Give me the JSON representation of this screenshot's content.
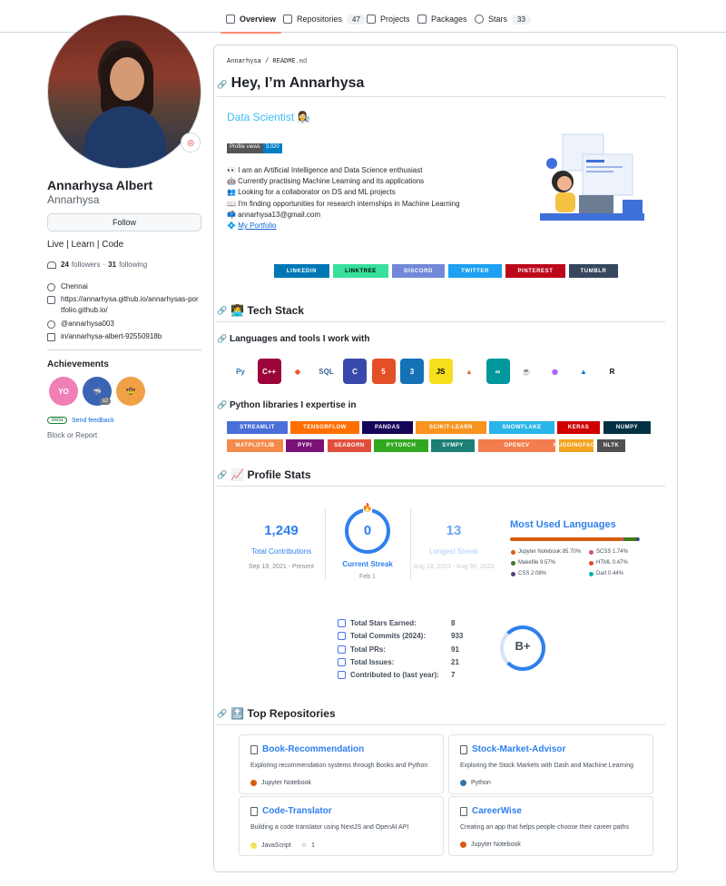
{
  "nav": {
    "tabs": [
      {
        "label": "Overview",
        "icon": "book-icon"
      },
      {
        "label": "Repositories",
        "icon": "repo-icon",
        "count": "47"
      },
      {
        "label": "Projects",
        "icon": "table-icon"
      },
      {
        "label": "Packages",
        "icon": "package-icon"
      },
      {
        "label": "Stars",
        "icon": "star-icon",
        "count": "33"
      }
    ]
  },
  "profile": {
    "full_name": "Annarhysa Albert",
    "login": "Annarhysa",
    "follow_label": "Follow",
    "bio": "Live | Learn | Code",
    "followers_count": "24",
    "followers_label": "followers",
    "dot": "·",
    "following_count": "31",
    "following_label": "following",
    "location": "Chennai",
    "website": "https://annarhysa.github.io/annarhysas-portfolio.github.io/",
    "twitter": "@annarhysa003",
    "linkedin": "in/annarhysa-albert-92550918b",
    "achievements_title": "Achievements",
    "achievements": [
      {
        "name": "YOLO",
        "color": "#ef7fb5"
      },
      {
        "name": "Pull Shark",
        "color": "#3c64b5",
        "multiplier": "x2"
      },
      {
        "name": "Quickdraw",
        "color": "#f0a045"
      }
    ],
    "beta_label": "Beta",
    "feedback_label": "Send feedback",
    "block_label": "Block or Report"
  },
  "readme": {
    "breadcrumb_user": "Annarhysa",
    "breadcrumb_sep": "/",
    "breadcrumb_file": "README",
    "breadcrumb_ext": ".md",
    "title": "Hey, I’m Annarhysa",
    "typing_text": "Data Scientist 👩‍🔬",
    "views_label": "Profile views",
    "views_count": "3,020",
    "about": [
      "👀 I am an Artificial Intelligence and Data Science enthusiast",
      "🤖 Currently practising Machine Learning and its applications",
      "👥 Looking for a collaborator on DS and ML projects",
      "📖 I'm finding opportunities for research internships in Machine Learning",
      "📫 annarhysa13@gmail.com",
      "💠"
    ],
    "portfolio_link": "My Portfolio",
    "socials": [
      {
        "label": "LINKEDIN",
        "color": "#0077b5"
      },
      {
        "label": "LINKTREE",
        "color": "#39e09b",
        "text_color": "#000000"
      },
      {
        "label": "DISCORD",
        "color": "#7289da"
      },
      {
        "label": "TWITTER",
        "color": "#1da1f2"
      },
      {
        "label": "PINTEREST",
        "color": "#bd081c"
      },
      {
        "label": "TUMBLR",
        "color": "#36465d"
      }
    ],
    "tech_stack_heading": "👩‍💻 Tech Stack",
    "languages_heading": "Languages and tools I work with",
    "tools": [
      {
        "name": "python-icon",
        "glyph": "Py",
        "bg": "#ffffff",
        "fg": "#3776ab"
      },
      {
        "name": "cplusplus-icon",
        "glyph": "C++",
        "bg": "#9c033a",
        "fg": "#ffffff"
      },
      {
        "name": "git-icon",
        "glyph": "◆",
        "bg": "#ffffff",
        "fg": "#f05032"
      },
      {
        "name": "sql-icon",
        "glyph": "SQL",
        "bg": "#ffffff",
        "fg": "#336791"
      },
      {
        "name": "c-icon",
        "glyph": "C",
        "bg": "#3949ab",
        "fg": "#ffffff"
      },
      {
        "name": "html5-icon",
        "glyph": "5",
        "bg": "#e34f26",
        "fg": "#ffffff"
      },
      {
        "name": "css3-icon",
        "glyph": "3",
        "bg": "#1572b6",
        "fg": "#ffffff"
      },
      {
        "name": "javascript-icon",
        "glyph": "JS",
        "bg": "#f7df1e",
        "fg": "#000000"
      },
      {
        "name": "matlab-icon",
        "glyph": "▲",
        "bg": "#ffffff",
        "fg": "#e16737"
      },
      {
        "name": "arduino-icon",
        "glyph": "∞",
        "bg": "#00979d",
        "fg": "#ffffff"
      },
      {
        "name": "java-icon",
        "glyph": "☕",
        "bg": "#ffffff",
        "fg": "#e76f00"
      },
      {
        "name": "figma-icon",
        "glyph": "◉",
        "bg": "#ffffff",
        "fg": "#a259ff"
      },
      {
        "name": "azure-icon",
        "glyph": "▲",
        "bg": "#ffffff",
        "fg": "#0078d4"
      },
      {
        "name": "rust-icon",
        "glyph": "R",
        "bg": "#ffffff",
        "fg": "#000000"
      }
    ],
    "libraries_heading": "Python libraries I expertise in",
    "libraries": [
      {
        "label": "STREAMLIT",
        "color": "#4a6fd8"
      },
      {
        "label": "TENSORFLOW",
        "color": "#ff6f00"
      },
      {
        "label": "PANDAS",
        "color": "#150458"
      },
      {
        "label": "SCIKIT-LEARN",
        "color": "#f7931e"
      },
      {
        "label": "SNOWFLAKE",
        "color": "#29b5e8"
      },
      {
        "label": "KERAS",
        "color": "#d00000"
      },
      {
        "label": "NUMPY",
        "color": "#013243"
      },
      {
        "label": "MATPLOTLIB",
        "color": "#f58a4b"
      },
      {
        "label": "PYPI",
        "color": "#7b1278"
      },
      {
        "label": "SEABORN",
        "color": "#e04f3c"
      },
      {
        "label": "PYTORCH",
        "color": "#31a81f"
      },
      {
        "label": "SYMPY",
        "color": "#1b7f75"
      },
      {
        "label": "OPENCV",
        "color": "#f47d4d"
      },
      {
        "label": "HUGGINGFACE",
        "color": "#f2a321"
      },
      {
        "label": "NLTK",
        "color": "#505050"
      }
    ],
    "profile_stats_heading": "📈 Profile Stats",
    "streak": {
      "total_contributions": "1,249",
      "total_contributions_label": "Total Contributions",
      "total_range": "Sep 19, 2021 - Present",
      "current_streak": "0",
      "current_streak_label": "Current Streak",
      "current_date": "Feb 1",
      "longest_streak": "13",
      "longest_streak_label": "Longest Streak",
      "longest_range": "Aug 18, 2023 - Aug 30, 2023"
    },
    "languages": {
      "title": "Most Used Languages",
      "items": [
        {
          "name": "Jupyter Notebook",
          "percent": "85.70%",
          "color": "#da5b0b",
          "value": 85.7
        },
        {
          "name": "SCSS",
          "percent": "1.74%",
          "color": "#c6538c",
          "value": 1.74
        },
        {
          "name": "Makefile",
          "percent": "9.57%",
          "color": "#427819",
          "value": 9.57
        },
        {
          "name": "HTML",
          "percent": "0.47%",
          "color": "#e34c26",
          "value": 0.47
        },
        {
          "name": "CSS",
          "percent": "2.08%",
          "color": "#563d7c",
          "value": 2.08
        },
        {
          "name": "Dart",
          "percent": "0.44%",
          "color": "#00b4ab",
          "value": 0.44
        }
      ]
    },
    "stats": {
      "rows": [
        {
          "label": "Total Stars Earned:",
          "value": "8"
        },
        {
          "label": "Total Commits (2024):",
          "value": "933"
        },
        {
          "label": "Total PRs:",
          "value": "91"
        },
        {
          "label": "Total Issues:",
          "value": "21"
        },
        {
          "label": "Contributed to (last year):",
          "value": "7"
        }
      ],
      "grade": "B+"
    },
    "top_repos_heading": "🔝 Top Repositories",
    "repos": [
      {
        "name": "Book-Recommendation",
        "desc": "Exploring recommendation systems through Books and Python",
        "lang": "Jupyter Notebook",
        "lang_color": "#da5b0b"
      },
      {
        "name": "Stock-Market-Advisor",
        "desc": "Exploring the Stock Markets with Dash and Machine Learning",
        "lang": "Python",
        "lang_color": "#3572a5"
      },
      {
        "name": "Code-Translator",
        "desc": "Building a code translator using NextJS and OpenAI API",
        "lang": "JavaScript",
        "lang_color": "#f1e05a",
        "stars": "1"
      },
      {
        "name": "CareerWise",
        "desc": "Creating an app that helps people choose their career paths",
        "lang": "Jupyter Notebook",
        "lang_color": "#da5b0b"
      }
    ]
  }
}
